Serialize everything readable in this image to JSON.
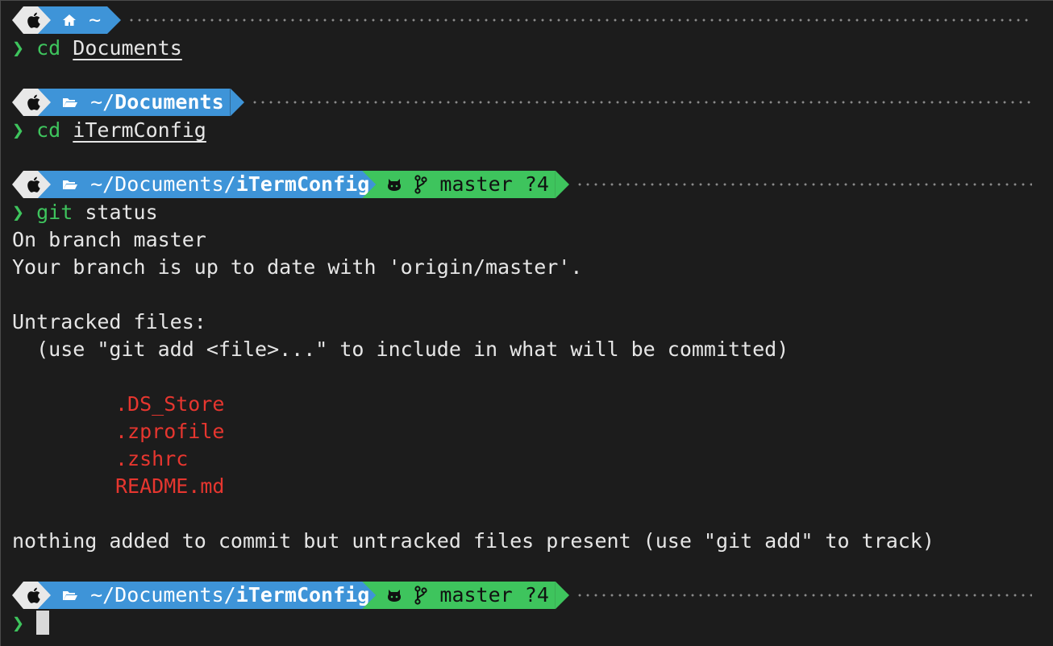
{
  "prompt_symbol": "❯",
  "home_segment": {
    "icon": "home-icon",
    "text": "~"
  },
  "block1": {
    "command": "cd",
    "argument": "Documents"
  },
  "block2": {
    "path_prefix": "~/",
    "path_bold": "Documents",
    "command": "cd",
    "argument": "iTermConfig"
  },
  "block3": {
    "path_prefix": "~/Documents/",
    "path_bold": "iTermConfig",
    "git_branch": "master",
    "git_status": "?4",
    "command": "git",
    "argument": "status",
    "output": {
      "line1": "On branch master",
      "line2": "Your branch is up to date with 'origin/master'.",
      "line3": "Untracked files:",
      "line4": "  (use \"git add <file>...\" to include in what will be committed)",
      "files": [
        ".DS_Store",
        ".zprofile",
        ".zshrc",
        "README.md"
      ],
      "line5": "nothing added to commit but untracked files present (use \"git add\" to track)"
    }
  },
  "block4": {
    "path_prefix": "~/Documents/",
    "path_bold": "iTermConfig",
    "git_branch": "master",
    "git_status": "?4"
  },
  "colors": {
    "background": "#1c1c1c",
    "apple_segment": "#e8e8e8",
    "dir_segment": "#3e94d8",
    "git_segment": "#3ec45d",
    "prompt_green": "#3ec45d",
    "untracked_red": "#e6362f"
  },
  "icons": [
    "apple-icon",
    "home-icon",
    "folder-open-icon",
    "github-icon",
    "git-branch-icon"
  ]
}
